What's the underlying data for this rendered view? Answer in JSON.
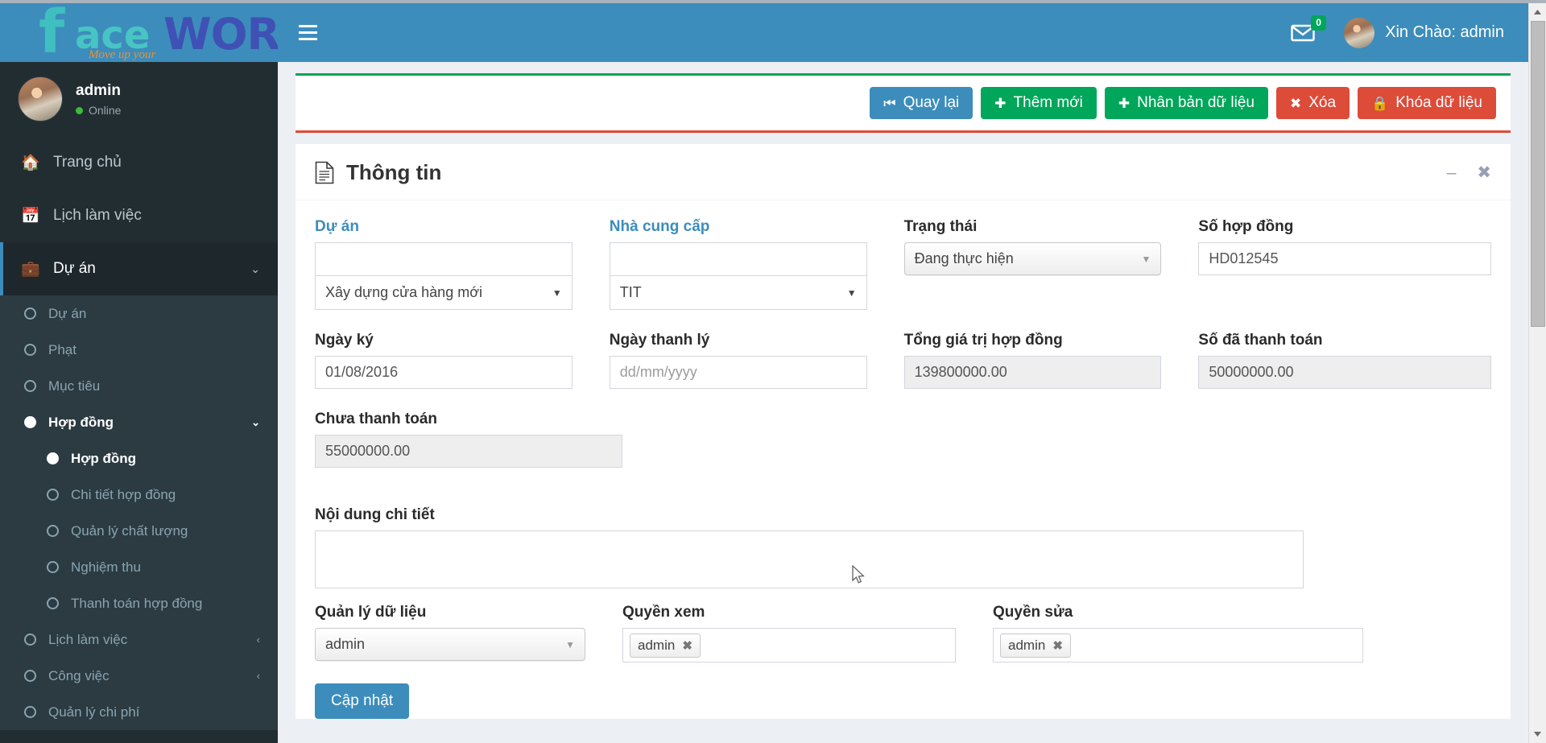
{
  "brand": {
    "logo_f": "f",
    "logo_ace": "ace",
    "logo_works": "WORKS",
    "logo_tagline": "Move up your",
    "color_primary": "#3c8dbc",
    "color_success": "#00a65a",
    "color_danger": "#dd4b39",
    "sidebar_bg": "#222d32"
  },
  "user_panel": {
    "name": "admin",
    "status": "Online",
    "avatar_icon": "avatar-photo"
  },
  "navbar": {
    "menu_toggle_icon": "hamburger-icon",
    "messages_icon": "envelope-icon",
    "messages_count": "0",
    "greeting": "Xin Chào: admin",
    "avatar_icon": "avatar-photo"
  },
  "sidebar": {
    "items": [
      {
        "label": "Trang chủ",
        "icon": "home-icon",
        "level": 1,
        "state": "normal",
        "chevron": ""
      },
      {
        "label": "Lịch làm việc",
        "icon": "calendar-icon",
        "level": 1,
        "state": "normal",
        "chevron": ""
      },
      {
        "label": "Dự án",
        "icon": "briefcase-icon",
        "level": 1,
        "state": "active",
        "chevron": "chevron-down-icon"
      }
    ],
    "sub_items": [
      {
        "label": "Dự án",
        "icon": "circle-o-icon",
        "level": 2,
        "state": "normal",
        "chevron": ""
      },
      {
        "label": "Phạt",
        "icon": "circle-o-icon",
        "level": 2,
        "state": "normal",
        "chevron": ""
      },
      {
        "label": "Mục tiêu",
        "icon": "circle-o-icon",
        "level": 2,
        "state": "normal",
        "chevron": ""
      },
      {
        "label": "Hợp đồng",
        "icon": "circle-filled-icon",
        "level": 2,
        "state": "current",
        "chevron": "chevron-down-icon"
      },
      {
        "label": "Hợp đồng",
        "icon": "circle-filled-icon",
        "level": 3,
        "state": "current",
        "chevron": ""
      },
      {
        "label": "Chi tiết hợp đồng",
        "icon": "circle-o-icon",
        "level": 3,
        "state": "normal",
        "chevron": ""
      },
      {
        "label": "Quản lý chất lượng",
        "icon": "circle-o-icon",
        "level": 3,
        "state": "normal",
        "chevron": ""
      },
      {
        "label": "Nghiệm thu",
        "icon": "circle-o-icon",
        "level": 3,
        "state": "normal",
        "chevron": ""
      },
      {
        "label": "Thanh toán hợp đồng",
        "icon": "circle-o-icon",
        "level": 3,
        "state": "normal",
        "chevron": ""
      },
      {
        "label": "Lịch làm việc",
        "icon": "circle-o-icon",
        "level": 2,
        "state": "normal",
        "chevron": "chevron-left-icon"
      },
      {
        "label": "Công việc",
        "icon": "circle-o-icon",
        "level": 2,
        "state": "normal",
        "chevron": "chevron-left-icon"
      },
      {
        "label": "Quản lý chi phí",
        "icon": "circle-o-icon",
        "level": 2,
        "state": "normal",
        "chevron": ""
      }
    ]
  },
  "toolbar": {
    "back_label": "Quay lại",
    "back_icon": "step-backward-icon",
    "add_label": "Thêm mới",
    "add_icon": "plus-icon",
    "clone_label": "Nhân bản dữ liệu",
    "clone_icon": "plus-icon",
    "delete_label": "Xóa",
    "delete_icon": "times-icon",
    "lock_label": "Khóa dữ liệu",
    "lock_icon": "lock-icon"
  },
  "panel": {
    "title": "Thông tin",
    "title_icon": "file-text-icon",
    "minimize_icon": "minus-icon",
    "close_icon": "times-icon"
  },
  "form": {
    "project": {
      "label": "Dự án",
      "search_value": "",
      "selected": "Xây dựng cửa hàng mới",
      "caret_icon": "caret-down-icon"
    },
    "supplier": {
      "label": "Nhà cung cấp",
      "search_value": "",
      "selected": "TIT",
      "caret_icon": "caret-down-icon"
    },
    "status": {
      "label": "Trạng thái",
      "selected": "Đang thực hiện",
      "caret_icon": "caret-down-icon"
    },
    "contract_no": {
      "label": "Số hợp đồng",
      "value": "HD012545"
    },
    "sign_date": {
      "label": "Ngày ký",
      "value": "01/08/2016"
    },
    "liquidation_date": {
      "label": "Ngày thanh lý",
      "value": "",
      "placeholder": "dd/mm/yyyy"
    },
    "total_value": {
      "label": "Tổng giá trị hợp đồng",
      "value": "139800000.00"
    },
    "paid": {
      "label": "Số đã thanh toán",
      "value": "50000000.00"
    },
    "unpaid": {
      "label": "Chưa thanh toán",
      "value": "55000000.00"
    },
    "details": {
      "label": "Nội dung chi tiết",
      "value": ""
    },
    "data_manager": {
      "label": "Quản lý dữ liệu",
      "selected": "admin",
      "caret_icon": "caret-down-icon"
    },
    "view_right": {
      "label": "Quyền xem",
      "tokens": [
        "admin"
      ],
      "remove_icon": "times-icon"
    },
    "edit_right": {
      "label": "Quyền sửa",
      "tokens": [
        "admin"
      ],
      "remove_icon": "times-icon"
    },
    "submit_label": "Cập nhật"
  }
}
